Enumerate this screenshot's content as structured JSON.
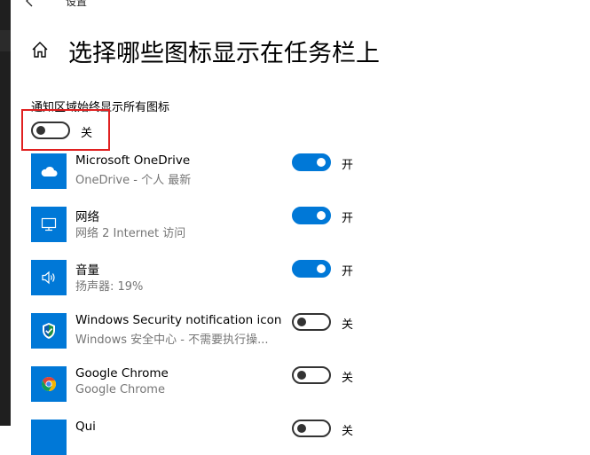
{
  "window": {
    "title": "设置"
  },
  "page": {
    "title": "选择哪些图标显示在任务栏上"
  },
  "always_show": {
    "label": "通知区域始终显示所有图标",
    "state": "关",
    "on": false
  },
  "items": [
    {
      "name": "Microsoft OneDrive",
      "sub": "OneDrive - 个人 最新",
      "state": "开",
      "on": true,
      "icon": "cloud-icon"
    },
    {
      "name": "网络",
      "sub": "网络 2 Internet 访问",
      "state": "开",
      "on": true,
      "icon": "monitor-icon"
    },
    {
      "name": "音量",
      "sub": "扬声器: 19%",
      "state": "开",
      "on": true,
      "icon": "speaker-icon"
    },
    {
      "name": "Windows Security notification icon",
      "sub": "Windows 安全中心 - 不需要执行操...",
      "state": "关",
      "on": false,
      "icon": "shield-icon"
    },
    {
      "name": "Google Chrome",
      "sub": "Google Chrome",
      "state": "关",
      "on": false,
      "icon": "chrome-icon"
    },
    {
      "name": "Qui",
      "sub": "",
      "state": "关",
      "on": false,
      "icon": "app-icon"
    }
  ]
}
